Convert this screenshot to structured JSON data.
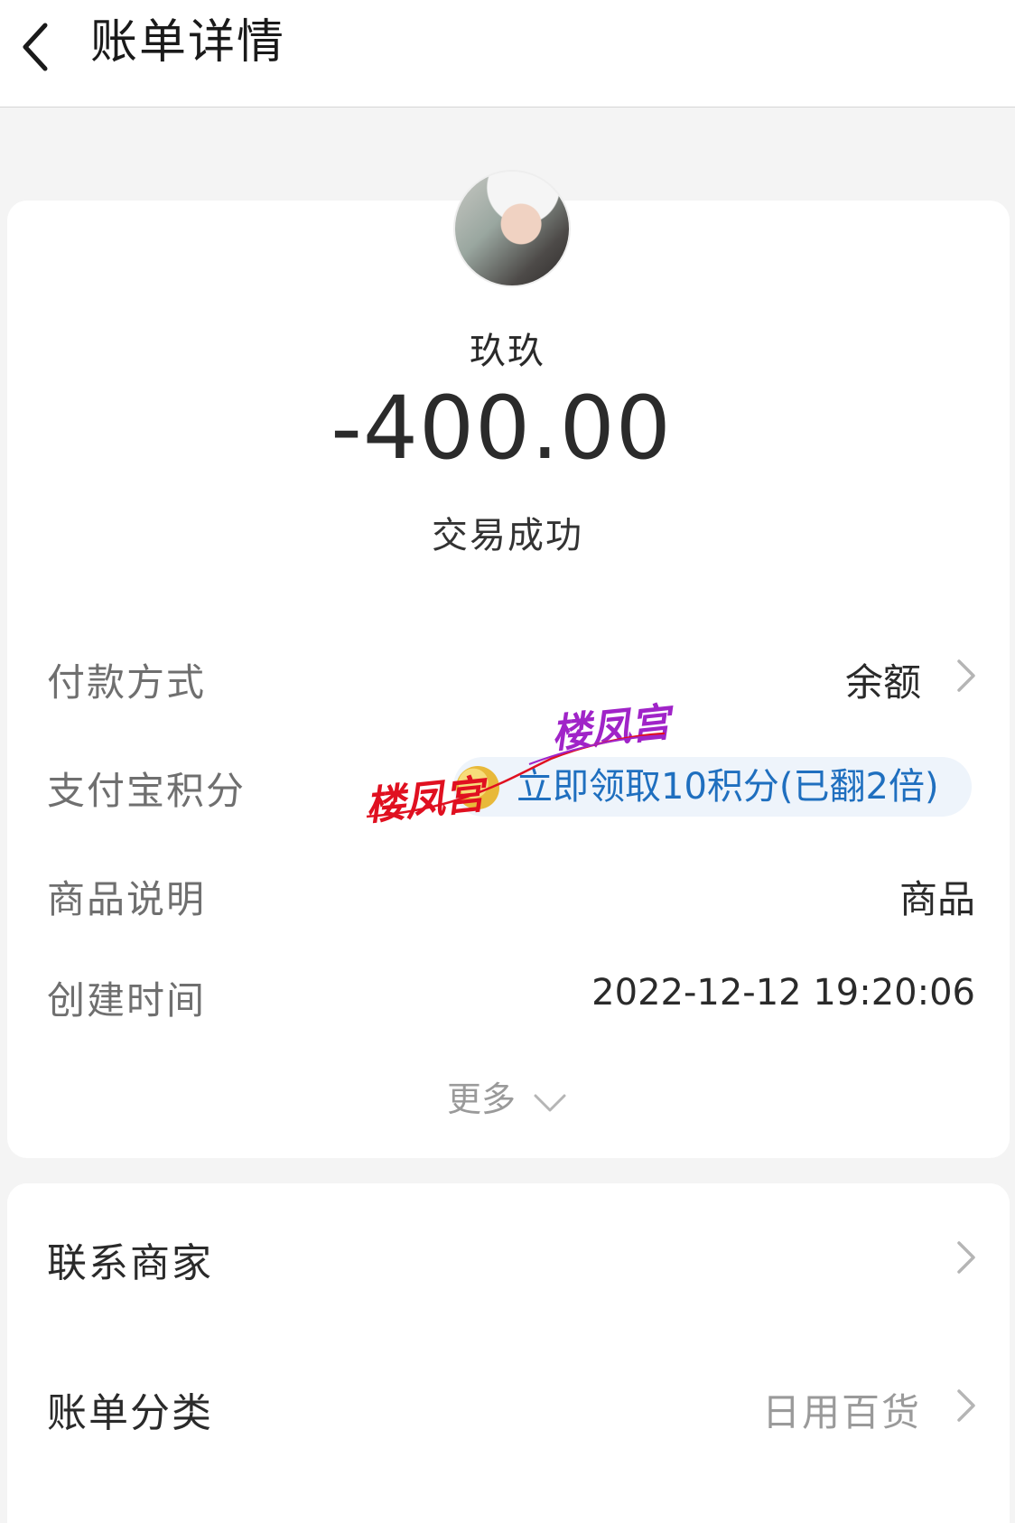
{
  "header": {
    "title": "账单详情"
  },
  "bill": {
    "merchant": "玖玖",
    "amount": "-400.00",
    "status": "交易成功"
  },
  "details": {
    "payment_method": {
      "label": "付款方式",
      "value": "余额"
    },
    "points": {
      "label": "支付宝积分",
      "value": "立即领取10积分(已翻2倍)"
    },
    "product": {
      "label": "商品说明",
      "value": "商品"
    },
    "created": {
      "label": "创建时间",
      "value": "2022-12-12 19:20:06"
    },
    "more": "更多"
  },
  "extra": {
    "contact": {
      "label": "联系商家"
    },
    "category": {
      "label": "账单分类",
      "value": "日用百货"
    }
  },
  "watermark": {
    "text": "楼凤宫",
    "colors": [
      "#a024c8",
      "#e01020"
    ]
  },
  "colors": {
    "link_blue": "#1f6fbf",
    "background": "#f4f4f4"
  },
  "icons": [
    "back-arrow-icon",
    "chevron-right-icon",
    "chevron-down-icon",
    "coin-icon"
  ]
}
